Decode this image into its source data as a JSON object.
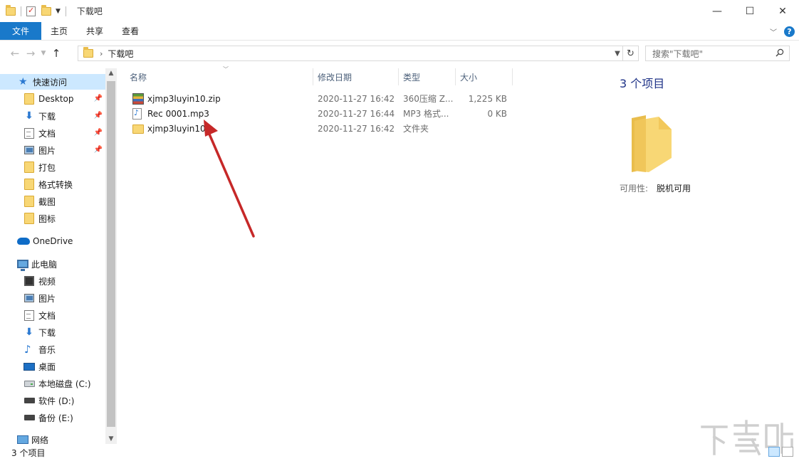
{
  "window": {
    "title": "下载吧",
    "controls": [
      "—",
      "☐",
      "✕"
    ]
  },
  "ribbon": {
    "tabs": [
      {
        "label": "文件"
      },
      {
        "label": "主页"
      },
      {
        "label": "共享"
      },
      {
        "label": "查看"
      }
    ]
  },
  "address": {
    "path": "下载吧",
    "search_placeholder": "搜索\"下载吧\""
  },
  "nav": {
    "quick_access": "快速访问",
    "quick_items": [
      {
        "label": "Desktop",
        "icon": "folder-icon",
        "pinned": true
      },
      {
        "label": "下载",
        "icon": "download-arrow-icon",
        "pinned": true
      },
      {
        "label": "文档",
        "icon": "document-icon",
        "pinned": true
      },
      {
        "label": "图片",
        "icon": "pictures-icon",
        "pinned": true
      },
      {
        "label": "打包",
        "icon": "folder-icon",
        "pinned": false
      },
      {
        "label": "格式转换",
        "icon": "folder-icon",
        "pinned": false
      },
      {
        "label": "截图",
        "icon": "folder-icon",
        "pinned": false
      },
      {
        "label": "图标",
        "icon": "folder-icon",
        "pinned": false
      }
    ],
    "onedrive": "OneDrive",
    "this_pc": "此电脑",
    "pc_items": [
      {
        "label": "视频",
        "icon": "video-icon"
      },
      {
        "label": "图片",
        "icon": "pictures-icon"
      },
      {
        "label": "文档",
        "icon": "document-icon"
      },
      {
        "label": "下载",
        "icon": "download-arrow-icon"
      },
      {
        "label": "音乐",
        "icon": "music-icon"
      },
      {
        "label": "桌面",
        "icon": "desktop-icon"
      },
      {
        "label": "本地磁盘 (C:)",
        "icon": "local-disk-icon"
      },
      {
        "label": "软件 (D:)",
        "icon": "drive-icon"
      },
      {
        "label": "备份 (E:)",
        "icon": "drive-icon"
      }
    ],
    "network": "网络"
  },
  "columns": {
    "name": "名称",
    "date": "修改日期",
    "type": "类型",
    "size": "大小"
  },
  "files": [
    {
      "name": "xjmp3luyin10.zip",
      "date": "2020-11-27 16:42",
      "type": "360压缩 Z...",
      "size": "1,225 KB",
      "icon": "zip-icon"
    },
    {
      "name": "Rec 0001.mp3",
      "date": "2020-11-27 16:44",
      "type": "MP3 格式...",
      "size": "0 KB",
      "icon": "mp3-file-icon"
    },
    {
      "name": "xjmp3luyin10",
      "date": "2020-11-27 16:42",
      "type": "文件夹",
      "size": "",
      "icon": "folder-icon"
    }
  ],
  "preview": {
    "item_count": "3 个项目",
    "availability_label": "可用性:",
    "availability_value": "脱机可用"
  },
  "status": {
    "text": "3 个项目"
  },
  "colors": {
    "file_tab": "#1979ca",
    "selection": "#cce8ff",
    "annotation_arrow": "#c62828",
    "item_count_text": "#1e3287"
  }
}
